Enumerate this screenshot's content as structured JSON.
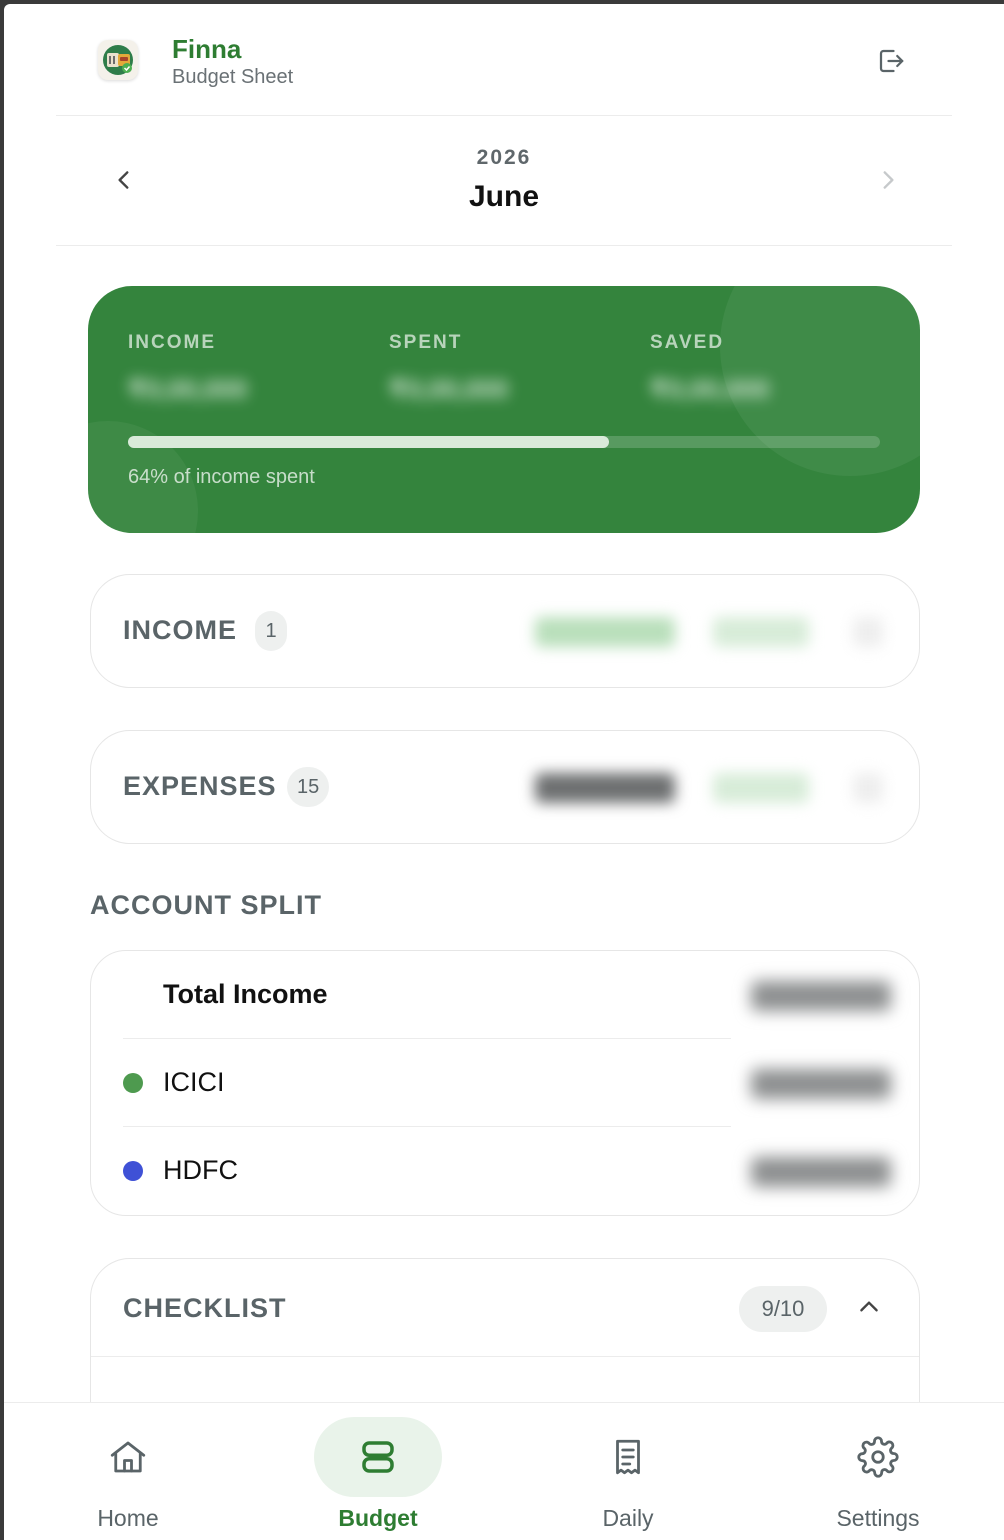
{
  "header": {
    "app_name": "Finna",
    "subtitle": "Budget Sheet",
    "logo_icon": "wallet-bank-icon",
    "logout_icon": "logout-icon"
  },
  "month_nav": {
    "year": "2026",
    "month": "June",
    "prev_icon": "chevron-left-icon",
    "next_icon": "chevron-right-icon"
  },
  "summary": {
    "income_label": "INCOME",
    "income_value": "₹0,00,000",
    "spent_label": "SPENT",
    "spent_value": "₹0,00,000",
    "saved_label": "SAVED",
    "saved_value": "₹0,00,000",
    "spent_percent": 64,
    "progress_text": "64% of income spent",
    "color_card": "#34843d"
  },
  "sections": {
    "income": {
      "title": "INCOME",
      "count": "1"
    },
    "expenses": {
      "title": "EXPENSES",
      "count": "15"
    }
  },
  "account_split": {
    "heading": "ACCOUNT SPLIT",
    "rows": [
      {
        "name": "Total Income",
        "color": ""
      },
      {
        "name": "ICICI",
        "color": "#4e9a4f"
      },
      {
        "name": "HDFC",
        "color": "#3f51d6"
      }
    ]
  },
  "checklist": {
    "title": "CHECKLIST",
    "progress": "9/10",
    "collapse_icon": "chevron-up-icon"
  },
  "bottom_nav": {
    "items": [
      {
        "label": "Home",
        "icon": "home-icon"
      },
      {
        "label": "Budget",
        "icon": "budget-icon"
      },
      {
        "label": "Daily",
        "icon": "receipt-icon"
      },
      {
        "label": "Settings",
        "icon": "gear-icon"
      }
    ],
    "active": "Budget",
    "color_active": "#2e7d32"
  }
}
